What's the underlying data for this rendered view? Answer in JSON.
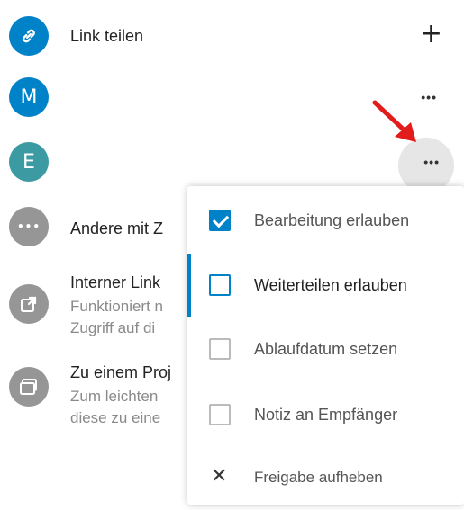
{
  "share_list": {
    "link_row": {
      "avatar_icon": "link-icon",
      "label": "Link teilen",
      "action_icon": "plus-icon",
      "action_glyph": "+"
    },
    "user_m": {
      "initial": "M",
      "more_glyph": "•••"
    },
    "user_e": {
      "initial": "E",
      "more_glyph": "•••"
    },
    "others_row": {
      "avatar_glyph": "•••",
      "label": "Andere mit Z"
    },
    "internal_link": {
      "label": "Interner Link",
      "sub1": "Funktioniert n",
      "sub2": "Zugriff auf di"
    },
    "project_row": {
      "label": "Zu einem Proj",
      "sub1": "Zum leichten",
      "sub2": "diese zu eine"
    }
  },
  "popup_menu": {
    "items": [
      {
        "label": "Bearbeitung erlauben",
        "checked": true
      },
      {
        "label": "Weiterteilen erlauben",
        "checked": false
      },
      {
        "label": "Ablaufdatum setzen",
        "checked": false
      },
      {
        "label": "Notiz an Empfänger",
        "checked": false
      },
      {
        "label": "Freigabe aufheben",
        "icon": "close-icon",
        "glyph": "✕"
      }
    ]
  },
  "colors": {
    "link_avatar": "#0082c9",
    "user_m_avatar": "#0082c9",
    "user_e_avatar": "#3c9aa3",
    "gray_avatar": "#969696",
    "accent": "#0082c9",
    "arrow": "#e21b1b"
  }
}
